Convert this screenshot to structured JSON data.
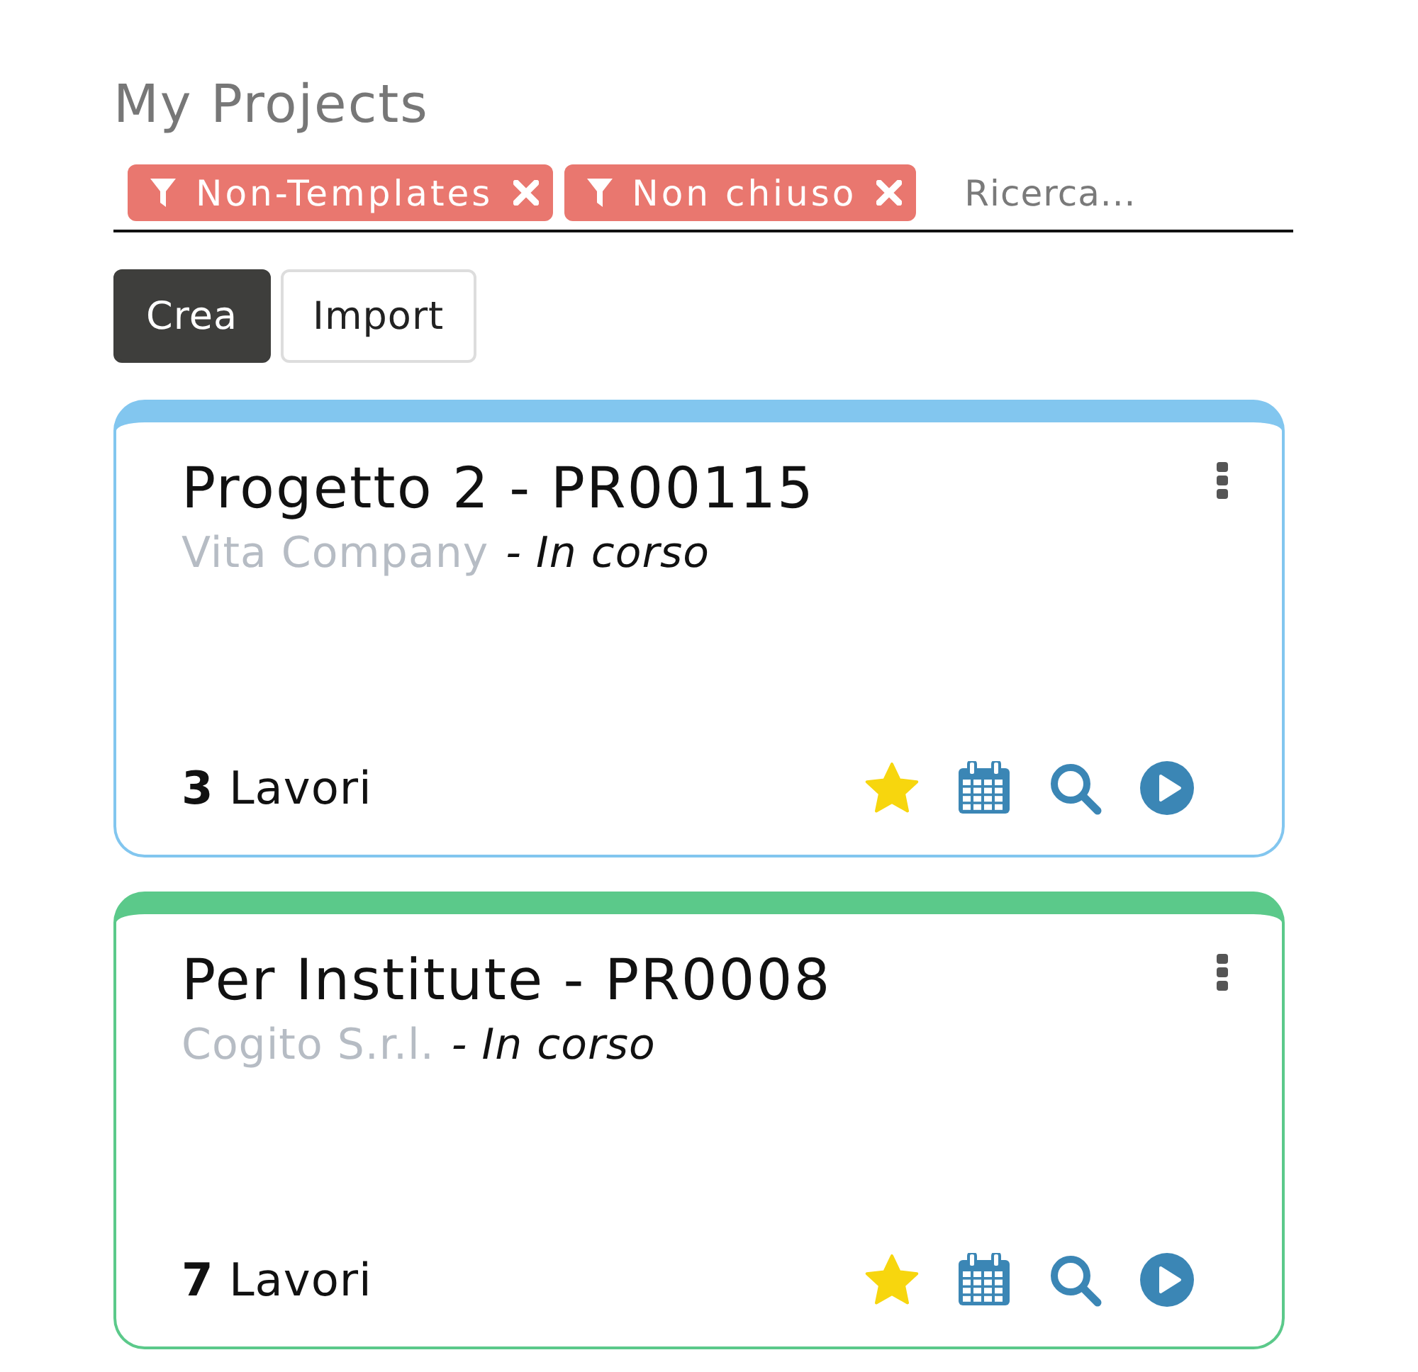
{
  "title": "My Projects",
  "search": {
    "facets": [
      {
        "label": "Non-Templates"
      },
      {
        "label": "Non chiuso"
      }
    ],
    "placeholder": "Ricerca..."
  },
  "buttons": [
    {
      "label": "Crea",
      "kind": "primary"
    },
    {
      "label": "Import",
      "kind": "secondary"
    }
  ],
  "projects": [
    {
      "name": "Progetto 2 - PR00115",
      "company": "Vita Company",
      "status": "- In corso",
      "color": "#82c6ef",
      "jobs": "**3** Lavori",
      "favorite": true
    },
    {
      "name": "Per Institute - PR0008",
      "company": "Cogito S.r.l.",
      "status": "- In corso",
      "color": "#5bc98a",
      "jobs": "**7** Lavori",
      "favorite": true
    }
  ]
}
